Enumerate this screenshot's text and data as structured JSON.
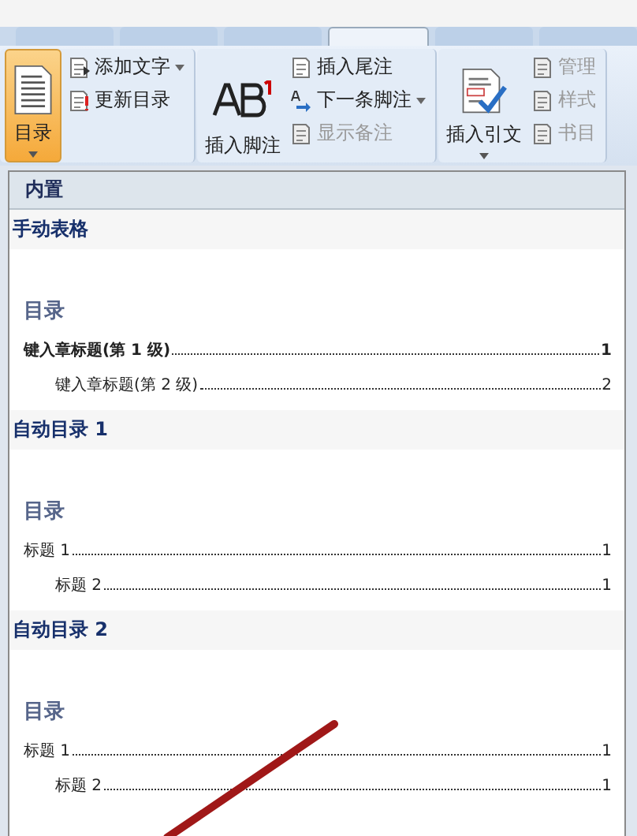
{
  "tabs": [
    {
      "selected": false
    },
    {
      "selected": false
    },
    {
      "selected": false
    },
    {
      "selected": true
    },
    {
      "selected": false
    },
    {
      "selected": false
    }
  ],
  "ribbon": {
    "groups": [
      {
        "big": {
          "label": "目录",
          "selected": true,
          "caret": true
        },
        "small": [
          {
            "label": "添加文字",
            "disabled": false,
            "caret": true
          },
          {
            "label": "更新目录",
            "disabled": false,
            "caret": false
          }
        ]
      },
      {
        "big": {
          "label": "插入脚注",
          "selected": false,
          "caret": false
        },
        "small": [
          {
            "label": "插入尾注",
            "disabled": false,
            "caret": false
          },
          {
            "label": "下一条脚注",
            "disabled": false,
            "caret": true
          },
          {
            "label": "显示备注",
            "disabled": true,
            "caret": false
          }
        ]
      },
      {
        "big": {
          "label": "插入引文",
          "selected": false,
          "caret": true
        },
        "small": [
          {
            "label": "管理",
            "disabled": true,
            "caret": false
          },
          {
            "label": "样式",
            "disabled": true,
            "caret": false
          },
          {
            "label": "书目",
            "disabled": true,
            "caret": false
          }
        ]
      }
    ]
  },
  "dropdown": {
    "header": "内置",
    "sections": [
      {
        "title": "手动表格",
        "toc_title": "目录",
        "entries": [
          {
            "text": "键入章标题(第 1 级)",
            "page": "1",
            "bold": true,
            "children": [
              {
                "text": "键入章标题(第 2 级)",
                "page": "2",
                "bold": false
              }
            ]
          }
        ]
      },
      {
        "title": "自动目录 1",
        "toc_title": "目录",
        "entries": [
          {
            "text": "标题 1",
            "page": "1",
            "bold": false,
            "children": [
              {
                "text": "标题 2",
                "page": "1",
                "bold": false
              }
            ]
          }
        ]
      },
      {
        "title": "自动目录 2",
        "toc_title": "目录",
        "entries": [
          {
            "text": "标题 1",
            "page": "1",
            "bold": false,
            "children": [
              {
                "text": "标题 2",
                "page": "1",
                "bold": false
              }
            ]
          }
        ]
      }
    ]
  }
}
